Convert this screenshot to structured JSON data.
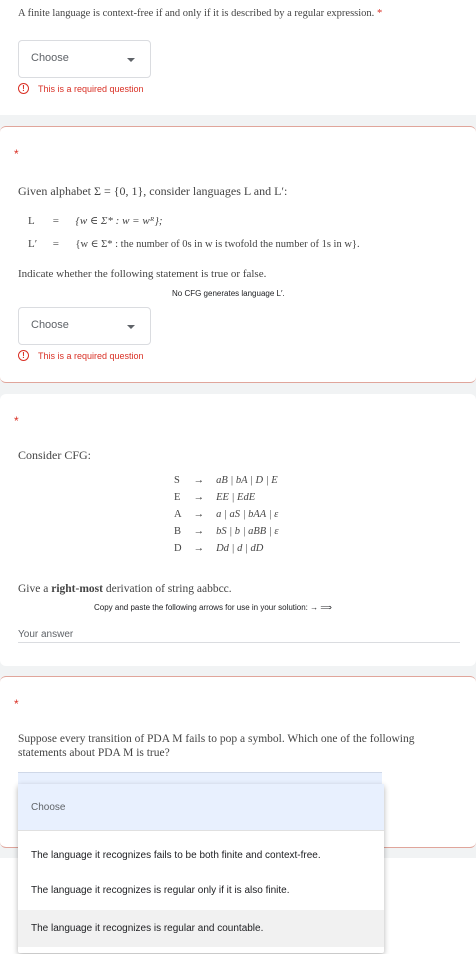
{
  "q1": {
    "text": "A finite language is context-free if and only if it is described by a regular expression.",
    "star": "*",
    "select": "Choose",
    "error": "This is a required question"
  },
  "q2": {
    "star": "*",
    "intro": "Given alphabet Σ = {0, 1}, consider languages L and L′:",
    "L_name": "L",
    "L_def": "{w ∈ Σ* : w = wᴿ};",
    "Lp_name": "L′",
    "Lp_def": "{w ∈ Σ* : the number of 0s in w is twofold the number of 1s in w}.",
    "eq": "=",
    "instruction": "Indicate whether the following statement is true or false.",
    "statement": "No CFG generates language L′.",
    "select": "Choose",
    "error": "This is a required question"
  },
  "q3": {
    "star": "*",
    "intro": "Consider CFG:",
    "rules": [
      {
        "lhs": "S",
        "arrow": "→",
        "rhs": "aB | bA | D | E"
      },
      {
        "lhs": "E",
        "arrow": "→",
        "rhs": "EE | EdE"
      },
      {
        "lhs": "A",
        "arrow": "→",
        "rhs": "a | aS | bAA | ε"
      },
      {
        "lhs": "B",
        "arrow": "→",
        "rhs": "bS | b | aBB | ε"
      },
      {
        "lhs": "D",
        "arrow": "→",
        "rhs": "Dd | d | dD"
      }
    ],
    "prompt_pre": "Give a ",
    "prompt_bold": "right-most",
    "prompt_post": " derivation of string aabbcc.",
    "copy_note": "Copy and paste the following arrows for use in your solution: → ⟹",
    "answer_placeholder": "Your answer"
  },
  "q4": {
    "star": "*",
    "text": "Suppose every transition of PDA M fails to pop a symbol. Which one of the following statements about PDA M is true?",
    "options": [
      "Choose",
      "The language it recognizes fails to be both finite and context-free.",
      "The language it recognizes is regular only if it is also finite.",
      "The language it recognizes is regular and countable."
    ]
  },
  "colors": {
    "error": "#d93025",
    "highlight": "#e8f0fe",
    "hover": "#f1f1f1"
  }
}
